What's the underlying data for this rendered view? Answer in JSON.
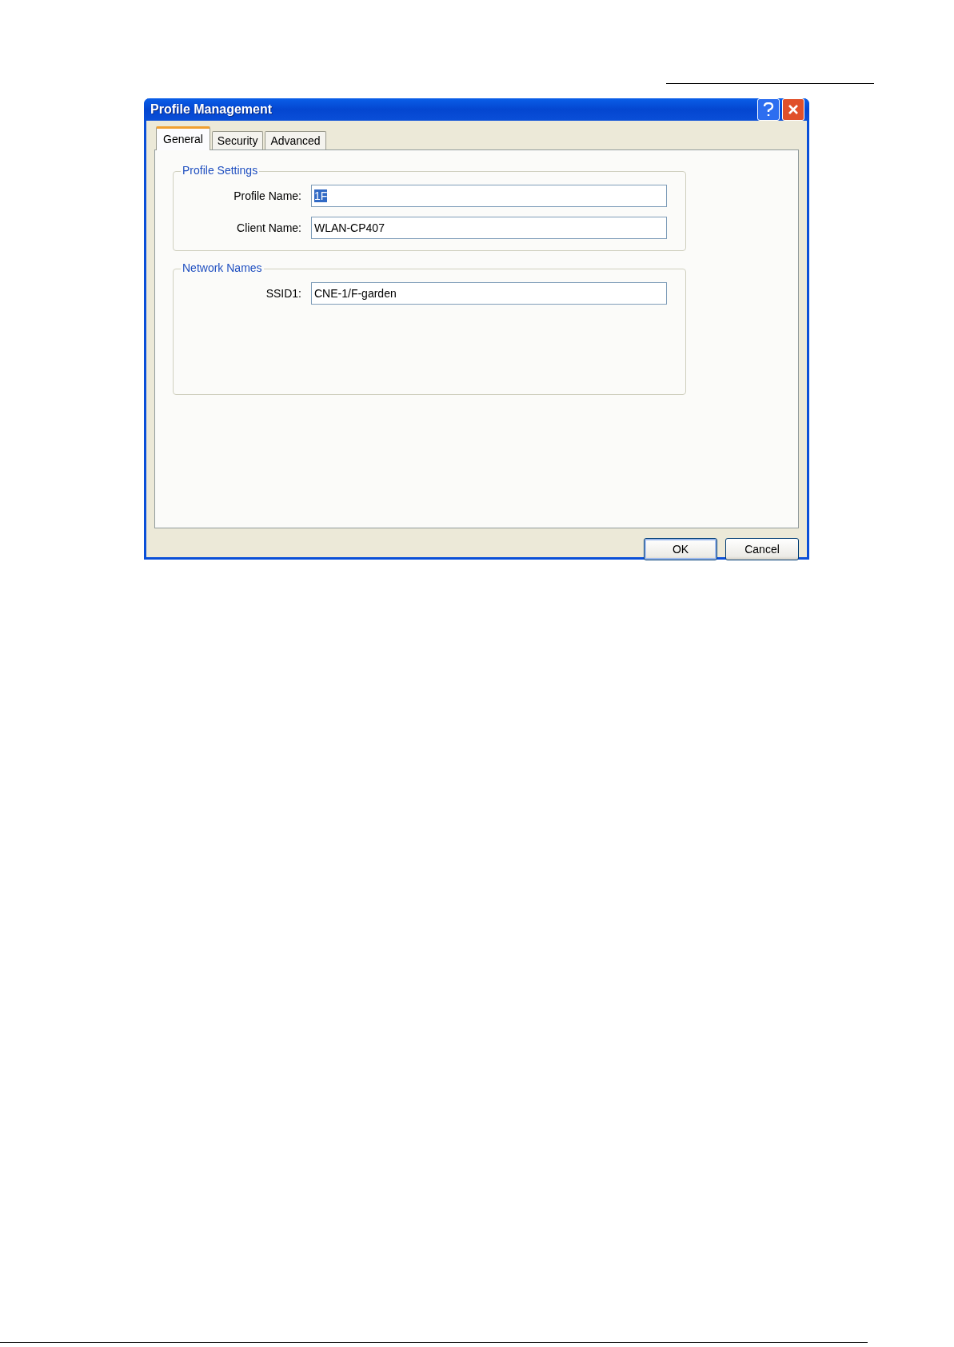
{
  "window": {
    "title": "Profile Management"
  },
  "tabs": [
    {
      "label": "General",
      "selected": true
    },
    {
      "label": "Security",
      "selected": false
    },
    {
      "label": "Advanced",
      "selected": false
    }
  ],
  "groups": [
    {
      "title": "Profile Settings",
      "fields": [
        {
          "label": "Profile Name:",
          "value": "1F",
          "text_selected": true
        },
        {
          "label": "Client Name:",
          "value": "WLAN-CP407",
          "text_selected": false
        }
      ]
    },
    {
      "title": "Network Names",
      "fields": [
        {
          "label": "SSID1:",
          "value": "CNE-1/F-garden",
          "text_selected": false
        }
      ]
    }
  ],
  "buttons": [
    {
      "label": "OK",
      "default": true
    },
    {
      "label": "Cancel",
      "default": false
    }
  ]
}
